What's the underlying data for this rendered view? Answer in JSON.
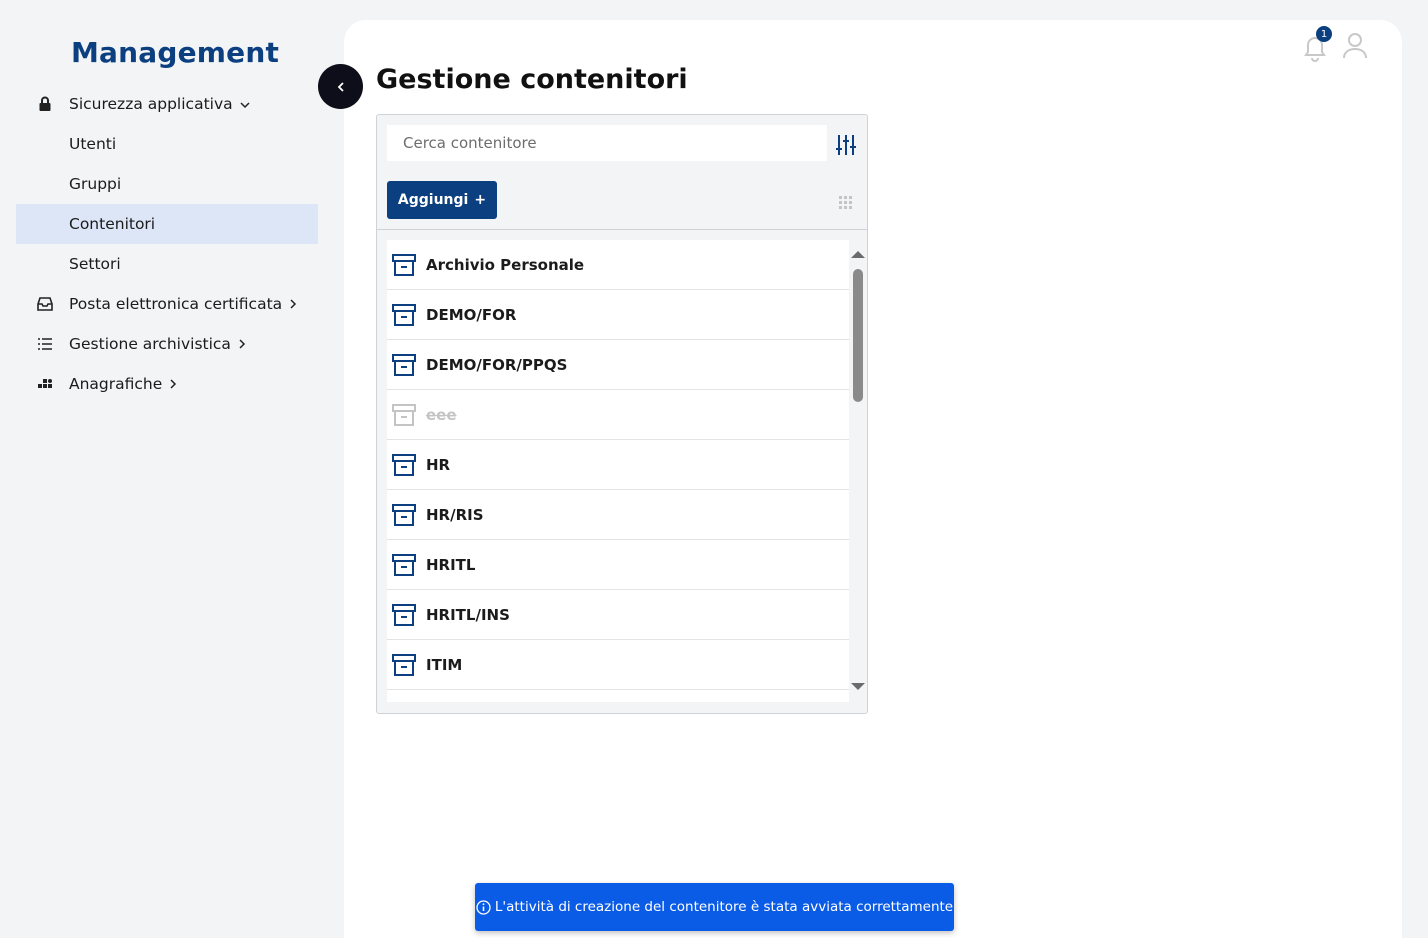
{
  "app": {
    "brand": "Management"
  },
  "sidebar": {
    "items": [
      {
        "label": "Sicurezza applicativa",
        "icon": "lock-icon",
        "chevron": "⌄",
        "level": 0
      },
      {
        "label": "Utenti",
        "level": 1
      },
      {
        "label": "Gruppi",
        "level": 1
      },
      {
        "label": "Contenitori",
        "level": 1,
        "active": true
      },
      {
        "label": "Settori",
        "level": 1
      },
      {
        "label": "Posta elettronica certificata",
        "icon": "inbox-icon",
        "chevron": "›",
        "level": 0
      },
      {
        "label": "Gestione archivistica",
        "icon": "list-icon",
        "chevron": "›",
        "level": 0
      },
      {
        "label": "Anagrafiche",
        "icon": "apps-icon",
        "chevron": "›",
        "level": 0
      }
    ]
  },
  "header": {
    "notifications_count": "1"
  },
  "main": {
    "title": "Gestione contenitori",
    "search": {
      "placeholder": "Cerca contenitore",
      "value": ""
    },
    "add_label": "Aggiungi",
    "add_symbol": "+",
    "containers": [
      {
        "name": "Archivio Personale",
        "disabled": false
      },
      {
        "name": "DEMO/FOR",
        "disabled": false
      },
      {
        "name": "DEMO/FOR/PPQS",
        "disabled": false
      },
      {
        "name": "eee",
        "disabled": true
      },
      {
        "name": "HR",
        "disabled": false
      },
      {
        "name": "HR/RIS",
        "disabled": false
      },
      {
        "name": "HRITL",
        "disabled": false
      },
      {
        "name": "HRITL/INS",
        "disabled": false
      },
      {
        "name": "ITIM",
        "disabled": false
      }
    ]
  },
  "toast": {
    "icon": "info-icon",
    "message": "L'attività di creazione del contenitore è stata avviata correttamente"
  },
  "colors": {
    "brand": "#0b3f7f",
    "active_bg": "#dde6f7",
    "toast_bg": "#0a5be6",
    "disabled": "#c4c4c4"
  }
}
